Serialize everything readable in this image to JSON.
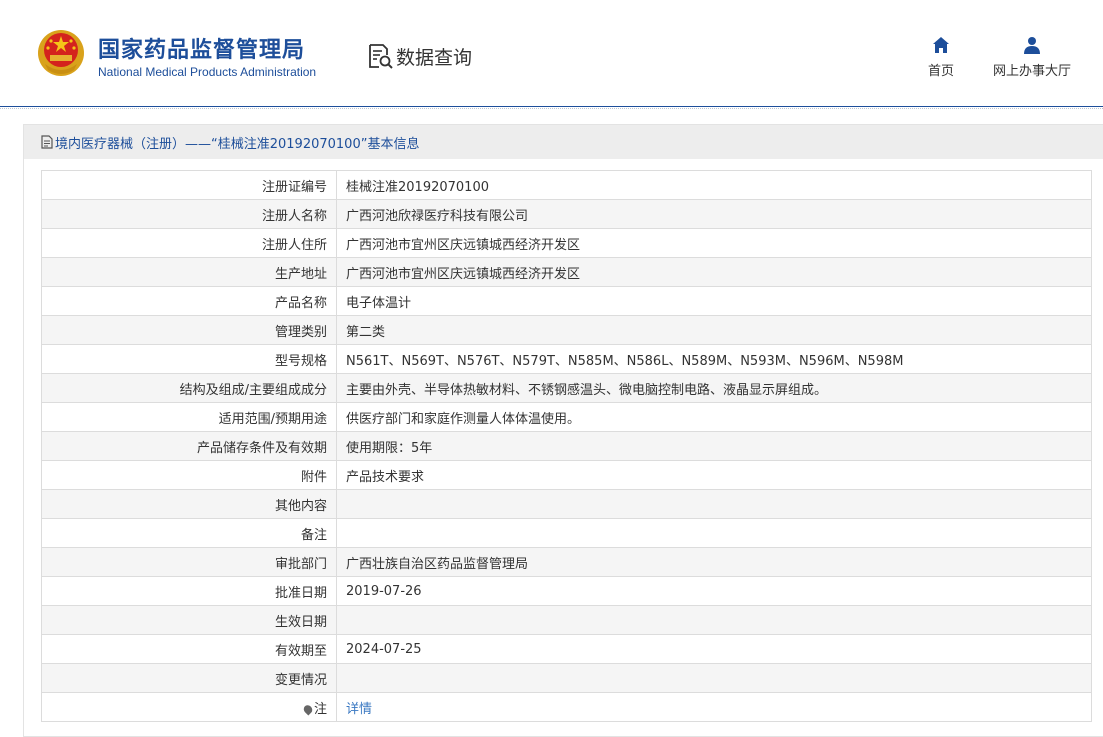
{
  "header": {
    "title_cn": "国家药品监督管理局",
    "title_en": "National Medical Products Administration",
    "section": "数据查询",
    "nav": [
      {
        "label": "首页",
        "icon": "home-icon"
      },
      {
        "label": "网上办事大厅",
        "icon": "user-icon"
      }
    ]
  },
  "colors": {
    "brand": "#1d4e9a",
    "link": "#3a78c2",
    "panel_header": "#ededed",
    "row_alt": "#f5f5f5"
  },
  "panel": {
    "title": "境内医疗器械（注册）——“桂械注准20192070100”基本信息"
  },
  "rows": [
    {
      "label": "注册证编号",
      "value": "桂械注准20192070100"
    },
    {
      "label": "注册人名称",
      "value": "广西河池欣禄医疗科技有限公司"
    },
    {
      "label": "注册人住所",
      "value": "广西河池市宜州区庆远镇城西经济开发区"
    },
    {
      "label": "生产地址",
      "value": "广西河池市宜州区庆远镇城西经济开发区"
    },
    {
      "label": "产品名称",
      "value": "电子体温计"
    },
    {
      "label": "管理类别",
      "value": "第二类"
    },
    {
      "label": "型号规格",
      "value": "N561T、N569T、N576T、N579T、N585M、N586L、N589M、N593M、N596M、N598M"
    },
    {
      "label": "结构及组成/主要组成成分",
      "value": "主要由外壳、半导体热敏材料、不锈钢感温头、微电脑控制电路、液晶显示屏组成。"
    },
    {
      "label": "适用范围/预期用途",
      "value": "供医疗部门和家庭作测量人体体温使用。"
    },
    {
      "label": "产品储存条件及有效期",
      "value": "使用期限：5年"
    },
    {
      "label": "附件",
      "value": "产品技术要求"
    },
    {
      "label": "其他内容",
      "value": ""
    },
    {
      "label": "备注",
      "value": ""
    },
    {
      "label": "审批部门",
      "value": "广西壮族自治区药品监督管理局"
    },
    {
      "label": "批准日期",
      "value": "2019-07-26"
    },
    {
      "label": "生效日期",
      "value": ""
    },
    {
      "label": "有效期至",
      "value": "2024-07-25"
    },
    {
      "label": "变更情况",
      "value": ""
    }
  ],
  "note_row": {
    "label": "注",
    "link_text": "详情"
  }
}
